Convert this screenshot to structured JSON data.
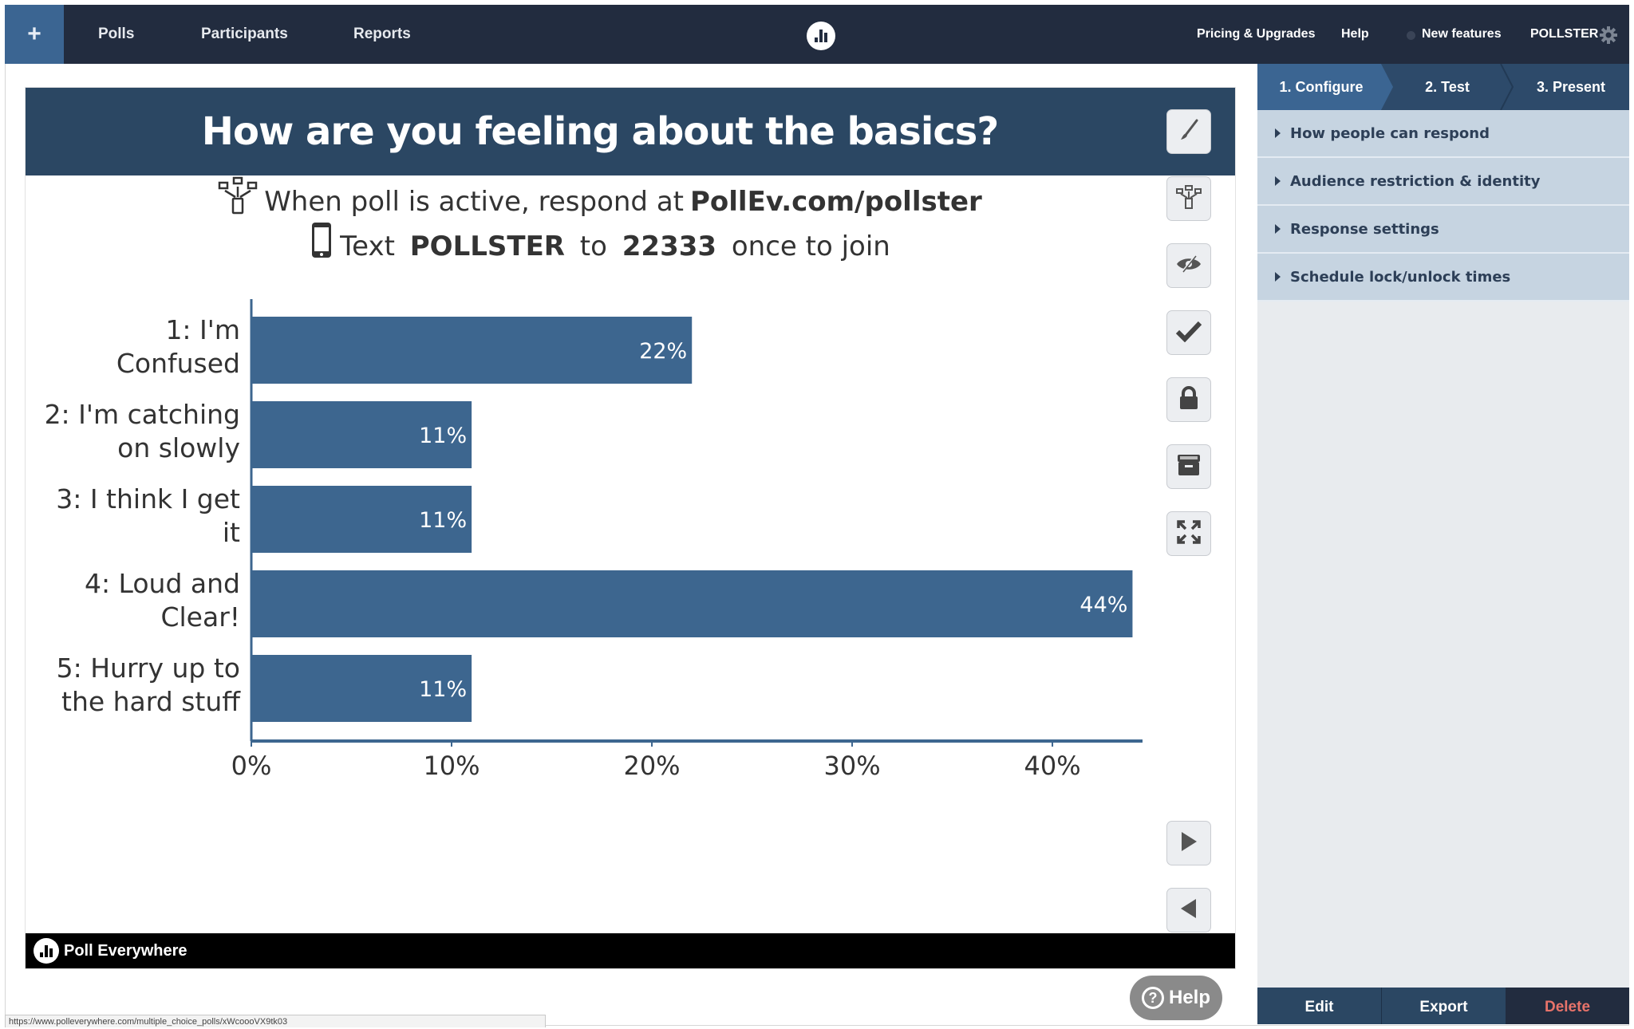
{
  "nav": {
    "add_label": "+",
    "links": [
      "Polls",
      "Participants",
      "Reports"
    ],
    "right": {
      "pricing": "Pricing & Upgrades",
      "help": "Help",
      "new_features": "New features",
      "account": "POLLSTER"
    }
  },
  "poll": {
    "title": "How are you feeling about the basics?",
    "instructions": {
      "web_prefix": "When poll is active, respond at ",
      "web_url": "PollEv.com/pollster",
      "text_prefix": "Text ",
      "text_keyword": "POLLSTER",
      "text_mid": " to ",
      "text_number": "22333",
      "text_suffix": " once to join"
    },
    "footer_brand": "Poll Everywhere"
  },
  "chart_data": {
    "type": "bar",
    "orientation": "horizontal",
    "title": "How are you feeling about the basics?",
    "categories": [
      [
        "1: I'm",
        "Confused"
      ],
      [
        "2: I'm catching",
        "on slowly"
      ],
      [
        "3: I think I get",
        "it"
      ],
      [
        "4: Loud and",
        "Clear!"
      ],
      [
        "5: Hurry up to",
        "the hard stuff"
      ]
    ],
    "values": [
      22,
      11,
      11,
      44,
      11
    ],
    "value_labels": [
      "22%",
      "11%",
      "11%",
      "44%",
      "11%"
    ],
    "xlabel": "",
    "ylabel": "",
    "xlim": [
      0,
      44
    ],
    "x_ticks": [
      0,
      10,
      20,
      30,
      40
    ],
    "x_tick_labels": [
      "0%",
      "10%",
      "20%",
      "30%",
      "40%"
    ],
    "grid": false,
    "bar_color": "#3d668f"
  },
  "toolbar": {
    "buttons": [
      "edit-style",
      "response-options",
      "hide-responses",
      "correct-answer",
      "lock",
      "archive",
      "fullscreen",
      "next",
      "previous"
    ]
  },
  "help_button": "Help",
  "status_url": "https://www.polleverywhere.com/multiple_choice_polls/xWcoooVX9tk03",
  "panel": {
    "steps": [
      "1. Configure",
      "2. Test",
      "3. Present"
    ],
    "active_step": 0,
    "sections": [
      "How people can respond",
      "Audience restriction & identity",
      "Response settings",
      "Schedule lock/unlock times"
    ],
    "actions": [
      "Edit",
      "Export",
      "Delete"
    ]
  },
  "colors": {
    "nav_bg": "#222c3f",
    "accent_blue": "#3b6592",
    "header_blue": "#2b4763",
    "bar": "#3d668f",
    "delete_red": "#e8736a"
  }
}
